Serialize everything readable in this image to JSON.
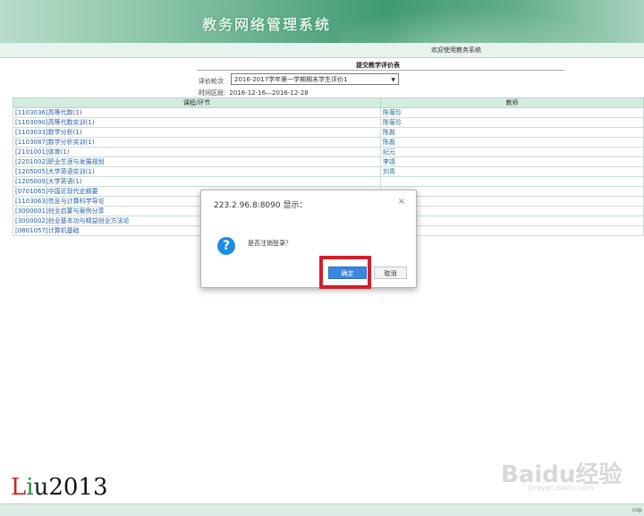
{
  "header": {
    "title": "教务网络管理系统"
  },
  "welcome": "欢迎使用教务系统",
  "form": {
    "title": "提交教学评价表",
    "round_label": "评价轮次",
    "round_value": "2016-2017学年第一学期期末学生评价1",
    "period_label": "时间区段:",
    "period_value": "2016-12-16—2016-12-28"
  },
  "table": {
    "headers": [
      "课程/环节",
      "教师"
    ],
    "rows": [
      {
        "course": "[1103036]高等代数(1)",
        "teacher": "陈菊珍"
      },
      {
        "course": "[1103090]高等代数实训(1)",
        "teacher": "陈菊珍"
      },
      {
        "course": "[1103033]数学分析(1)",
        "teacher": "陈磊"
      },
      {
        "course": "[1103087]数学分析实训(1)",
        "teacher": "陈磊"
      },
      {
        "course": "[2101001]体育(1)",
        "teacher": "纪元"
      },
      {
        "course": "[2201002]职业生涯与发展规划",
        "teacher": "李靖"
      },
      {
        "course": "[1205005]大学英语实训(1)",
        "teacher": "刘青"
      },
      {
        "course": "[1205009]大学英语(1)",
        "teacher": ""
      },
      {
        "course": "[0701065]中国近现代史纲要",
        "teacher": ""
      },
      {
        "course": "[1103063]信息与计算科学导论",
        "teacher": ""
      },
      {
        "course": "[3000001]创业启蒙与案例分享",
        "teacher": ""
      },
      {
        "course": "[3000002]创业基本功与精益创业方法论",
        "teacher": ""
      },
      {
        "course": "[0801057]计算机基础",
        "teacher": ""
      }
    ]
  },
  "dialog": {
    "title": "223.2.96.8:8090 显示：",
    "close": "×",
    "message": "是否注销登录？",
    "ok_label": "确定",
    "cancel_label": "取消"
  },
  "signature": "Liu2013",
  "watermark": {
    "main": "Baidu经验",
    "sub": "jingyan.baidu.com"
  },
  "footer": "cop",
  "colors": {
    "header": "#3f9a72",
    "highlight": "#d11f2b",
    "ok": "#3a86e0"
  }
}
